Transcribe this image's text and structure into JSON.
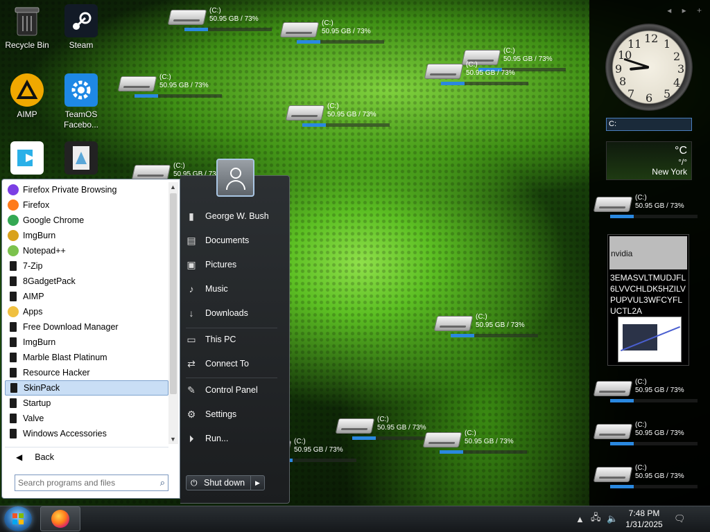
{
  "desktop": {
    "icons": [
      {
        "label": "Recycle Bin",
        "icon": "recycle-bin-icon"
      },
      {
        "label": "Steam",
        "icon": "steam-icon"
      },
      {
        "label": "AIMP",
        "icon": "aimp-icon"
      },
      {
        "label": "TeamOS Facebo...",
        "icon": "settings-gear-icon"
      }
    ],
    "drive_name": "(C:)",
    "drive_info": "50.95 GB / 73%",
    "drive_usage_fraction": 0.27
  },
  "sidebar": {
    "nav": "◂ ▸ +",
    "clock": {
      "numbers": [
        "12",
        "1",
        "2",
        "3",
        "4",
        "5",
        "6",
        "7",
        "8",
        "9",
        "10",
        "11"
      ],
      "hour": 8,
      "minute": 48
    },
    "search_value": "C:",
    "weather": {
      "unit": "°C",
      "sub": "°/°",
      "city": "New York"
    },
    "note": {
      "title": "nvidia",
      "body": "3EMASVLTMUDJFL6LVVCHLDK5HZILVPUPVUL3WFCYFLUCTL2A"
    }
  },
  "start_menu": {
    "programs": [
      {
        "label": "Firefox Private Browsing",
        "icon": "firefox-private-icon",
        "color": "#7b3fe4"
      },
      {
        "label": "Firefox",
        "icon": "firefox-icon",
        "color": "#ff7b1a"
      },
      {
        "label": "Google Chrome",
        "icon": "chrome-icon",
        "color": "#34a853"
      },
      {
        "label": "ImgBurn",
        "icon": "imgburn-icon",
        "color": "#d9a21b"
      },
      {
        "label": "Notepad++",
        "icon": "notepadpp-icon",
        "color": "#7cc24d"
      },
      {
        "label": "7-Zip",
        "icon": "folder-icon"
      },
      {
        "label": "8GadgetPack",
        "icon": "folder-icon"
      },
      {
        "label": "AIMP",
        "icon": "folder-icon"
      },
      {
        "label": "Apps",
        "icon": "apps-icon",
        "color": "#f0c040"
      },
      {
        "label": "Free Download Manager",
        "icon": "folder-icon"
      },
      {
        "label": "ImgBurn",
        "icon": "folder-icon"
      },
      {
        "label": "Marble Blast Platinum",
        "icon": "folder-icon"
      },
      {
        "label": "Resource Hacker",
        "icon": "folder-icon"
      },
      {
        "label": "SkinPack",
        "icon": "folder-icon",
        "selected": true
      },
      {
        "label": "Startup",
        "icon": "folder-icon"
      },
      {
        "label": "Valve",
        "icon": "folder-icon"
      },
      {
        "label": "Windows Accessories",
        "icon": "folder-icon"
      }
    ],
    "back_label": "Back",
    "search_placeholder": "Search programs and files",
    "right_links": [
      {
        "label": "George W. Bush",
        "icon": "user-folder-icon"
      },
      {
        "label": "Documents",
        "icon": "documents-icon"
      },
      {
        "label": "Pictures",
        "icon": "pictures-icon"
      },
      {
        "label": "Music",
        "icon": "music-icon"
      },
      {
        "label": "Downloads",
        "icon": "downloads-icon"
      },
      {
        "label": "This PC",
        "icon": "computer-icon"
      },
      {
        "label": "Connect To",
        "icon": "connect-icon"
      },
      {
        "label": "Control Panel",
        "icon": "control-panel-icon"
      },
      {
        "label": "Settings",
        "icon": "settings-icon"
      },
      {
        "label": "Run...",
        "icon": "run-icon"
      }
    ],
    "shutdown_label": "Shut down"
  },
  "taskbar": {
    "time": "7:48 PM",
    "date": "1/31/2025"
  }
}
